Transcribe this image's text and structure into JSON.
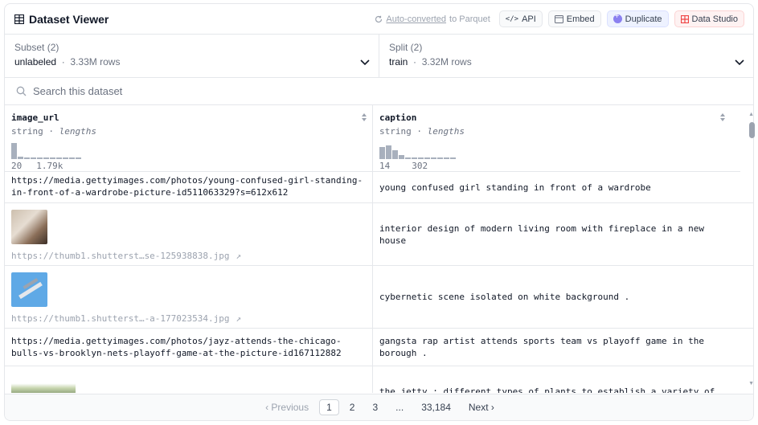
{
  "header": {
    "title": "Dataset Viewer",
    "auto_converted": "Auto-converted",
    "to_parquet": "to Parquet",
    "api_label": "API",
    "embed_label": "Embed",
    "duplicate_label": "Duplicate",
    "studio_label": "Data Studio"
  },
  "subset": {
    "label": "Subset (2)",
    "value": "unlabeled",
    "rows": "3.33M rows"
  },
  "split": {
    "label": "Split (2)",
    "value": "train",
    "rows": "3.32M rows"
  },
  "search": {
    "placeholder": "Search this dataset"
  },
  "columns": [
    {
      "name": "image_url",
      "type": "string",
      "stat": "lengths",
      "min": "20",
      "max": "1.79k",
      "hist": [
        1.0,
        0.15,
        0.08,
        0.08,
        0.08,
        0.08,
        0.08,
        0.08,
        0.08,
        0.08,
        0.08
      ]
    },
    {
      "name": "caption",
      "type": "string",
      "stat": "lengths",
      "min": "14",
      "max": "302",
      "hist": [
        0.75,
        0.85,
        0.55,
        0.25,
        0.1,
        0.08,
        0.08,
        0.08,
        0.08,
        0.08,
        0.08,
        0.08
      ]
    }
  ],
  "rows": [
    {
      "url": "https://media.gettyimages.com/photos/young-confused-girl-standing-in-front-of-a-wardrobe-picture-id511063329?s=612x612",
      "caption": "young confused girl standing in front of a wardrobe"
    },
    {
      "link": "https://thumb1.shutterst…se-125938838.jpg",
      "caption": "interior design of modern living room with fireplace in a new house"
    },
    {
      "link": "https://thumb1.shutterst…-a-177023534.jpg",
      "caption": "cybernetic scene isolated on white background ."
    },
    {
      "url": "https://media.gettyimages.com/photos/jayz-attends-the-chicago-bulls-vs-brooklyn-nets-playoff-game-at-the-picture-id167112882",
      "caption": "gangsta rap artist attends sports team vs playoff game in the borough ."
    },
    {
      "caption": "the jetty : different types of plants to establish a variety of"
    }
  ],
  "pager": {
    "previous": "Previous",
    "pages": [
      "1",
      "2",
      "3",
      "...",
      "33,184"
    ],
    "next": "Next"
  }
}
